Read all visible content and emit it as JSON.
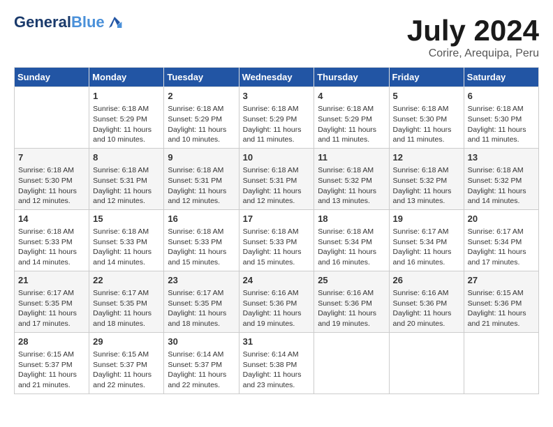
{
  "header": {
    "logo_line1": "General",
    "logo_line2": "Blue",
    "month_year": "July 2024",
    "location": "Corire, Arequipa, Peru"
  },
  "days_of_week": [
    "Sunday",
    "Monday",
    "Tuesday",
    "Wednesday",
    "Thursday",
    "Friday",
    "Saturday"
  ],
  "weeks": [
    [
      {
        "day": "",
        "info": ""
      },
      {
        "day": "1",
        "info": "Sunrise: 6:18 AM\nSunset: 5:29 PM\nDaylight: 11 hours\nand 10 minutes."
      },
      {
        "day": "2",
        "info": "Sunrise: 6:18 AM\nSunset: 5:29 PM\nDaylight: 11 hours\nand 10 minutes."
      },
      {
        "day": "3",
        "info": "Sunrise: 6:18 AM\nSunset: 5:29 PM\nDaylight: 11 hours\nand 11 minutes."
      },
      {
        "day": "4",
        "info": "Sunrise: 6:18 AM\nSunset: 5:29 PM\nDaylight: 11 hours\nand 11 minutes."
      },
      {
        "day": "5",
        "info": "Sunrise: 6:18 AM\nSunset: 5:30 PM\nDaylight: 11 hours\nand 11 minutes."
      },
      {
        "day": "6",
        "info": "Sunrise: 6:18 AM\nSunset: 5:30 PM\nDaylight: 11 hours\nand 11 minutes."
      }
    ],
    [
      {
        "day": "7",
        "info": "Sunrise: 6:18 AM\nSunset: 5:30 PM\nDaylight: 11 hours\nand 12 minutes."
      },
      {
        "day": "8",
        "info": "Sunrise: 6:18 AM\nSunset: 5:31 PM\nDaylight: 11 hours\nand 12 minutes."
      },
      {
        "day": "9",
        "info": "Sunrise: 6:18 AM\nSunset: 5:31 PM\nDaylight: 11 hours\nand 12 minutes."
      },
      {
        "day": "10",
        "info": "Sunrise: 6:18 AM\nSunset: 5:31 PM\nDaylight: 11 hours\nand 12 minutes."
      },
      {
        "day": "11",
        "info": "Sunrise: 6:18 AM\nSunset: 5:32 PM\nDaylight: 11 hours\nand 13 minutes."
      },
      {
        "day": "12",
        "info": "Sunrise: 6:18 AM\nSunset: 5:32 PM\nDaylight: 11 hours\nand 13 minutes."
      },
      {
        "day": "13",
        "info": "Sunrise: 6:18 AM\nSunset: 5:32 PM\nDaylight: 11 hours\nand 14 minutes."
      }
    ],
    [
      {
        "day": "14",
        "info": "Sunrise: 6:18 AM\nSunset: 5:33 PM\nDaylight: 11 hours\nand 14 minutes."
      },
      {
        "day": "15",
        "info": "Sunrise: 6:18 AM\nSunset: 5:33 PM\nDaylight: 11 hours\nand 14 minutes."
      },
      {
        "day": "16",
        "info": "Sunrise: 6:18 AM\nSunset: 5:33 PM\nDaylight: 11 hours\nand 15 minutes."
      },
      {
        "day": "17",
        "info": "Sunrise: 6:18 AM\nSunset: 5:33 PM\nDaylight: 11 hours\nand 15 minutes."
      },
      {
        "day": "18",
        "info": "Sunrise: 6:18 AM\nSunset: 5:34 PM\nDaylight: 11 hours\nand 16 minutes."
      },
      {
        "day": "19",
        "info": "Sunrise: 6:17 AM\nSunset: 5:34 PM\nDaylight: 11 hours\nand 16 minutes."
      },
      {
        "day": "20",
        "info": "Sunrise: 6:17 AM\nSunset: 5:34 PM\nDaylight: 11 hours\nand 17 minutes."
      }
    ],
    [
      {
        "day": "21",
        "info": "Sunrise: 6:17 AM\nSunset: 5:35 PM\nDaylight: 11 hours\nand 17 minutes."
      },
      {
        "day": "22",
        "info": "Sunrise: 6:17 AM\nSunset: 5:35 PM\nDaylight: 11 hours\nand 18 minutes."
      },
      {
        "day": "23",
        "info": "Sunrise: 6:17 AM\nSunset: 5:35 PM\nDaylight: 11 hours\nand 18 minutes."
      },
      {
        "day": "24",
        "info": "Sunrise: 6:16 AM\nSunset: 5:36 PM\nDaylight: 11 hours\nand 19 minutes."
      },
      {
        "day": "25",
        "info": "Sunrise: 6:16 AM\nSunset: 5:36 PM\nDaylight: 11 hours\nand 19 minutes."
      },
      {
        "day": "26",
        "info": "Sunrise: 6:16 AM\nSunset: 5:36 PM\nDaylight: 11 hours\nand 20 minutes."
      },
      {
        "day": "27",
        "info": "Sunrise: 6:15 AM\nSunset: 5:36 PM\nDaylight: 11 hours\nand 21 minutes."
      }
    ],
    [
      {
        "day": "28",
        "info": "Sunrise: 6:15 AM\nSunset: 5:37 PM\nDaylight: 11 hours\nand 21 minutes."
      },
      {
        "day": "29",
        "info": "Sunrise: 6:15 AM\nSunset: 5:37 PM\nDaylight: 11 hours\nand 22 minutes."
      },
      {
        "day": "30",
        "info": "Sunrise: 6:14 AM\nSunset: 5:37 PM\nDaylight: 11 hours\nand 22 minutes."
      },
      {
        "day": "31",
        "info": "Sunrise: 6:14 AM\nSunset: 5:38 PM\nDaylight: 11 hours\nand 23 minutes."
      },
      {
        "day": "",
        "info": ""
      },
      {
        "day": "",
        "info": ""
      },
      {
        "day": "",
        "info": ""
      }
    ]
  ]
}
